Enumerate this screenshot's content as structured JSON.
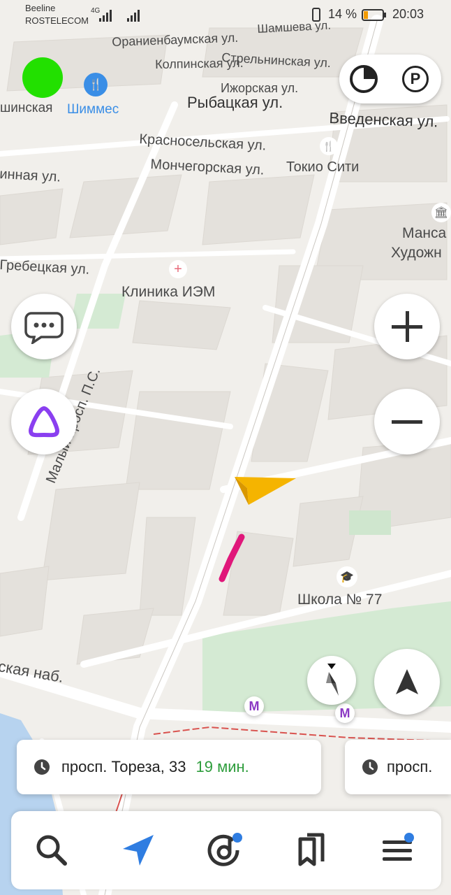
{
  "status_bar": {
    "carrier_1": "Beeline",
    "carrier_2": "ROSTELECOM",
    "network_type": "4G",
    "battery_percent": "14 %",
    "time": "20:03"
  },
  "map": {
    "street_labels": [
      "Шамшева ул.",
      "Ораниенбаумская ул.",
      "Стрельнинская ул.",
      "Колпинская ул.",
      "Ижорская ул.",
      "Рыбацкая ул.",
      "Введенская ул.",
      "Красносельская ул.",
      "Мончегорская ул.",
      "инная ул.",
      "Гребецкая ул.",
      "Малый просп. П.С.",
      "ская наб."
    ],
    "poi_labels": {
      "shop": "Шиммес",
      "left_edge": "шинская",
      "restaurant": "Токио Сити",
      "clinic": "Клиника ИЭМ",
      "museum_line1": "Манса",
      "museum_line2": "Художн",
      "school": "Школа № 77"
    },
    "colors": {
      "route_current": "#e0177a",
      "location_arrow": "#f5b400",
      "metro": "#8b39c4",
      "poi_restaurant": "#3a8ee6",
      "park": "#d4ead3"
    }
  },
  "controls": {
    "profile_status_color": "#22e000",
    "layers_icon": "layers-icon",
    "parking_label": "P",
    "zoom_in_icon": "plus-icon",
    "zoom_out_icon": "minus-icon",
    "compass_icon": "compass-icon",
    "locate_icon": "navigation-arrow-icon",
    "messages_icon": "chat-icon",
    "alice_icon": "alice-icon"
  },
  "route_cards": [
    {
      "address": "просп. Тореза, 33",
      "eta": "19 мин."
    },
    {
      "address": "просп.",
      "eta": ""
    }
  ],
  "bottom_nav": {
    "items": [
      "search-icon",
      "navigator-icon",
      "music-icon",
      "bookmarks-icon",
      "menu-icon"
    ],
    "active_color": "#2f7de1"
  }
}
